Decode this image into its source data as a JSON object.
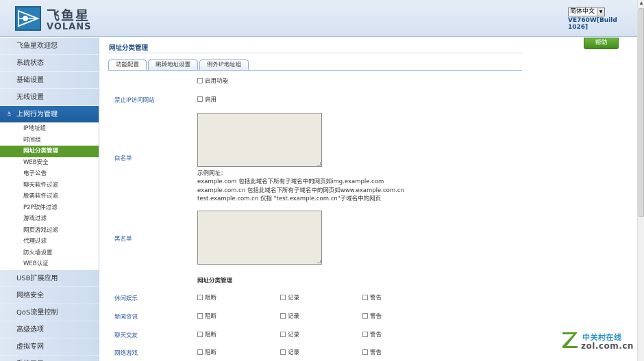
{
  "header": {
    "brand_cn": "飞鱼星",
    "brand_en": "VOLANS",
    "language": "简体中文",
    "model": "VE760W[Build 1026]"
  },
  "sidebar": {
    "items_before": [
      {
        "label": "飞鱼星欢迎您"
      },
      {
        "label": "系统状态"
      },
      {
        "label": "基础设置"
      },
      {
        "label": "无线设置"
      }
    ],
    "active_group": {
      "label": "上网行为管理",
      "fold_icon": "double-chevron-down"
    },
    "sub_items": [
      {
        "label": "IP地址组"
      },
      {
        "label": "时间组"
      },
      {
        "label": "网址分类管理",
        "active": true
      },
      {
        "label": "WEB安全"
      },
      {
        "label": "电子公告"
      },
      {
        "label": "聊天软件过滤"
      },
      {
        "label": "股票软件过滤"
      },
      {
        "label": "P2P软件过滤"
      },
      {
        "label": "游戏过滤"
      },
      {
        "label": "网页游戏过滤"
      },
      {
        "label": "代理过滤"
      },
      {
        "label": "防火墙设置"
      },
      {
        "label": "WEB认证"
      }
    ],
    "items_after": [
      {
        "label": "USB扩展应用"
      },
      {
        "label": "网络安全"
      },
      {
        "label": "QoS流量控制"
      },
      {
        "label": "高级选项"
      },
      {
        "label": "虚拟专网"
      },
      {
        "label": "系统工具"
      }
    ]
  },
  "main": {
    "page_title": "网址分类管理",
    "help_label": "帮助",
    "tabs": [
      {
        "label": "功能配置",
        "selected": true
      },
      {
        "label": "跳转地址设置"
      },
      {
        "label": "例外IP地址组"
      }
    ],
    "enable_function_label": "启用功能",
    "block_ip_label": "禁止IP访问网站",
    "block_ip_enable_label": "启用",
    "whitelist_label": "白名单",
    "example_lines": [
      "示例网址：",
      "example.com 包括此域名下所有子域名中的网页如img.example.com",
      "example.com.cn 包括此域名下所有子域名中的网页如www.example.com.cn",
      "test.example.com.cn 仅指 \"test.example.com.cn\"子域名中的网页"
    ],
    "blacklist_label": "黑名单",
    "category_section_title": "网址分类管理",
    "action_labels": {
      "block": "阻断",
      "log": "记录",
      "alert": "警告"
    },
    "categories": [
      {
        "label": "休闲娱乐"
      },
      {
        "label": "新闻资讯"
      },
      {
        "label": "聊天交友"
      },
      {
        "label": "网络游戏"
      }
    ]
  },
  "watermark": {
    "cn": "中关村在线",
    "en": "zol.com.cn"
  },
  "colors": {
    "accent": "#1e5d9d",
    "active_sub": "#5b9b2c",
    "help_button": "#4f9e2a",
    "link_label": "#2a5aa0"
  }
}
